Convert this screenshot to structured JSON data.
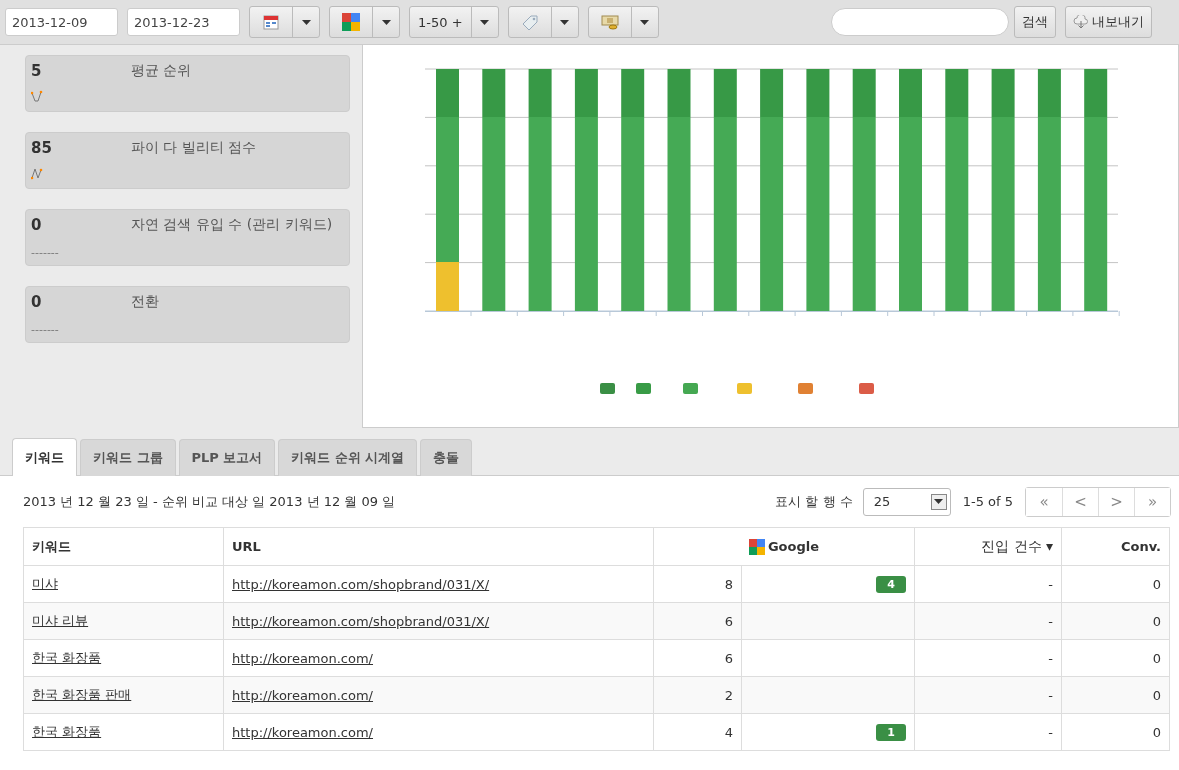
{
  "toolbar": {
    "start_date": "2013-12-09",
    "end_date": "2013-12-23",
    "range_button": "1-50 +",
    "search_button": "검색",
    "export_button": "내보내기"
  },
  "stats": [
    {
      "value": "5",
      "label": "평균 순위",
      "kind": "sparkline"
    },
    {
      "value": "85",
      "label": "파이 다 빌리티 점수",
      "kind": "sparkline"
    },
    {
      "value": "0",
      "label": "자연 검색 유입 수 (관리 키워드)",
      "kind": "dashes",
      "dashes": "-------"
    },
    {
      "value": "0",
      "label": "전환",
      "kind": "dashes",
      "dashes": "-------"
    }
  ],
  "tabs": [
    {
      "label": "키워드",
      "selected": true
    },
    {
      "label": "키워드 그룹",
      "selected": false
    },
    {
      "label": "PLP 보고서",
      "selected": false
    },
    {
      "label": "키워드 순위 시계열",
      "selected": false
    },
    {
      "label": "충돌",
      "selected": false
    }
  ],
  "summary": "2013 년 12 월 23 일 - 순위 비교 대상 일 2013 년 12 월 09 일",
  "pager": {
    "rows_label": "표시 할 행 수",
    "rows_value": "25",
    "page_info": "1-5 of 5",
    "buttons": [
      "«",
      "<",
      ">",
      "»"
    ]
  },
  "table": {
    "columns": [
      {
        "label": "키워드"
      },
      {
        "label": "URL"
      },
      {
        "label": "Google"
      },
      {
        "label": "진입 건수",
        "sort_mark": "▾"
      },
      {
        "label": "Conv."
      }
    ],
    "rows": [
      {
        "keyword": "미샤",
        "url": "http://koreamon.com/shopbrand/031/X/",
        "rank": "8",
        "change": "4",
        "visits": "-",
        "conv": "0"
      },
      {
        "keyword": "미샤 리뷰",
        "url": "http://koreamon.com/shopbrand/031/X/",
        "rank": "6",
        "visits": "-",
        "conv": "0"
      },
      {
        "keyword": "한국 화장품",
        "url": "http://koreamon.com/",
        "rank": "6",
        "visits": "-",
        "conv": "0"
      },
      {
        "keyword": "한국 화장품 판매",
        "url": "http://koreamon.com/",
        "rank": "2",
        "visits": "-",
        "conv": "0"
      },
      {
        "keyword": "한국 화장품",
        "url": "http://koreamon.com/",
        "rank": "4",
        "change": "1",
        "visits": "-",
        "conv": "0"
      }
    ]
  }
}
